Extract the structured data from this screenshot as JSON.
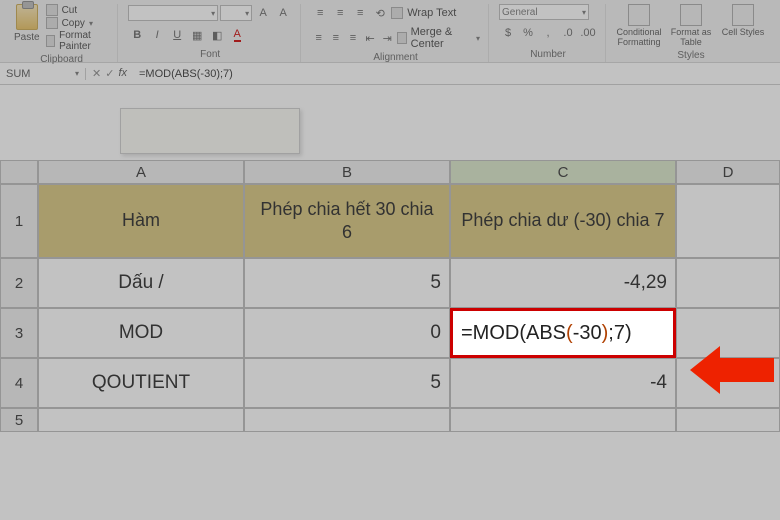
{
  "ribbon": {
    "clipboard": {
      "paste": "Paste",
      "cut": "Cut",
      "copy": "Copy",
      "fmt": "Format Painter",
      "label": "Clipboard"
    },
    "font": {
      "selector": "",
      "size": "",
      "label": "Font"
    },
    "alignment": {
      "wrap": "Wrap Text",
      "merge": "Merge & Center",
      "label": "Alignment"
    },
    "number": {
      "selector": "General",
      "label": "Number"
    },
    "styles": {
      "cond": "Conditional Formatting",
      "fmt": "Format as Table",
      "cell": "Cell Styles",
      "label": "Styles"
    }
  },
  "namebox": "SUM",
  "formula": "=MOD(ABS(-30);7)",
  "cols": {
    "A": "A",
    "B": "B",
    "C": "C",
    "D": "D"
  },
  "rowlabels": {
    "r1": "1",
    "r2": "2",
    "r3": "3",
    "r4": "4",
    "r5": "5"
  },
  "cells": {
    "A1": "Hàm",
    "B1": "Phép chia hết 30 chia 6",
    "C1": "Phép chia dư (-30) chia 7",
    "A2": "Dấu /",
    "B2": "5",
    "C2": "-4,29",
    "A3": "MOD",
    "B3": "0",
    "C3_prefix": "=MOD(ABS",
    "C3_paren1": "(",
    "C3_inner": "-30",
    "C3_paren2": ")",
    "C3_suffix": ";7)",
    "A4": "QOUTIENT",
    "B4": "5",
    "C4": "-4"
  },
  "colors": {
    "headerFill": "#d7c57c",
    "arrow": "#e20",
    "editBorder": "#c00"
  }
}
